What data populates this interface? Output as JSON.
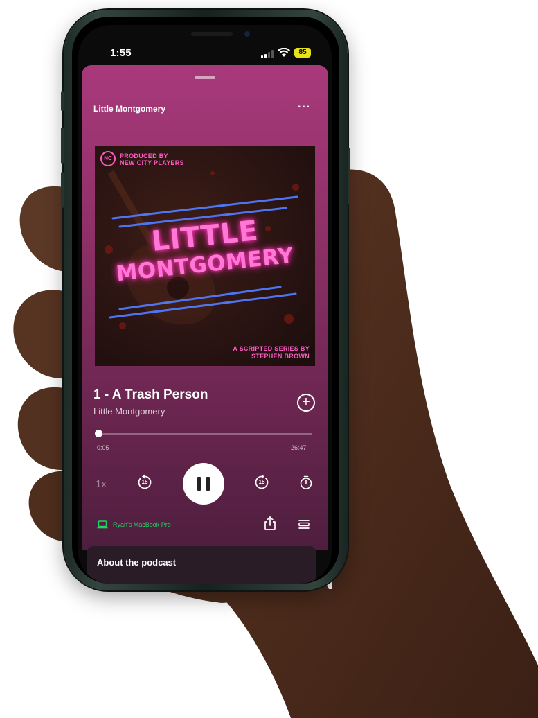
{
  "status_bar": {
    "time": "1:55",
    "battery": "85",
    "battery_color": "#e7e21c"
  },
  "player": {
    "header_title": "Little Montgomery",
    "more_icon": "ellipsis-icon",
    "accent_color": "#a8397b",
    "artwork": {
      "produced_line1": "PRODUCED BY",
      "produced_line2": "NEW CITY PLAYERS",
      "title_line1": "LITTLE",
      "title_line2": "MONTGOMERY",
      "footer_line1": "A SCRIPTED SERIES BY",
      "footer_line2": "STEPHEN BROWN"
    },
    "episode_title": "1 - A Trash Person",
    "show_name": "Little Montgomery",
    "add_icon": "plus-circle-icon",
    "progress": {
      "elapsed": "0:05",
      "remaining": "-26:47",
      "fraction": 0.003
    },
    "controls": {
      "speed_label": "1x",
      "skip_back_label": "15",
      "skip_forward_label": "15",
      "play_state_icon": "pause-icon",
      "timer_icon": "sleep-timer-icon"
    },
    "device": {
      "label": "Ryan's MacBook Pro",
      "color": "#1ed760",
      "icon": "laptop-icon"
    },
    "share_icon": "share-icon",
    "queue_icon": "queue-icon"
  },
  "about": {
    "title": "About the podcast"
  }
}
